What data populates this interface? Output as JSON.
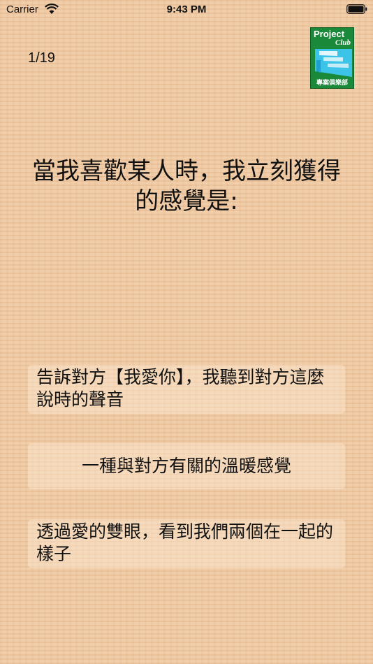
{
  "status_bar": {
    "carrier": "Carrier",
    "time": "9:43 PM"
  },
  "quiz": {
    "progress": "1/19",
    "question": "當我喜歡某人時，我立刻獲得的感覺是:",
    "options": [
      {
        "label": "告訴對方【我愛你】，我聽到對方這麼說時的聲音"
      },
      {
        "label": "一種與對方有關的溫暖感覺"
      },
      {
        "label": "透過愛的雙眼，看到我們兩個在一起的樣子"
      }
    ]
  },
  "logo": {
    "word1": "Project",
    "word2": "Club",
    "caption": "專案俱樂部"
  },
  "colors": {
    "background": "#efc9a2",
    "logo_green": "#1a8a3a",
    "logo_blue": "#3cc4e8"
  }
}
